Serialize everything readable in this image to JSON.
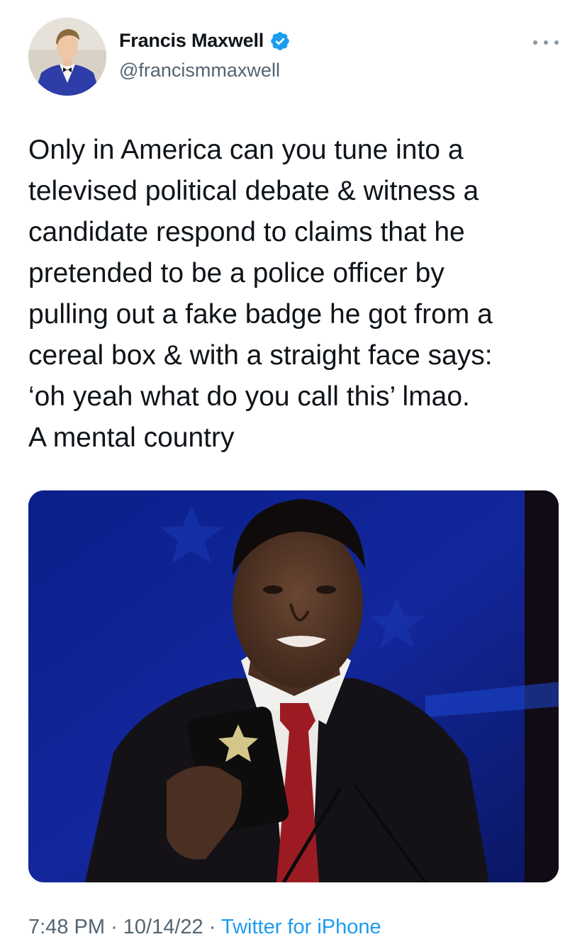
{
  "author": {
    "display_name": "Francis Maxwell",
    "handle": "@francismmaxwell",
    "verified": true,
    "avatar_icon": "profile-photo",
    "verified_icon": "verified-badge-icon"
  },
  "tweet": {
    "lines": [
      "Only in America can you tune into a",
      "televised political debate & witness a",
      "candidate respond to claims that he",
      "pretended to be a police officer by",
      "pulling out a fake badge he got from a",
      "cereal box & with a straight face says:",
      "‘oh yeah what do you call this’ lmao.",
      "A mental country"
    ],
    "media": {
      "type": "photo"
    }
  },
  "meta": {
    "time": "7:48 PM",
    "separator": "·",
    "date": "10/14/22",
    "source": "Twitter for iPhone"
  },
  "colors": {
    "accent": "#1d9bf0",
    "secondary_text": "#536471",
    "primary_text": "#0f1419"
  }
}
